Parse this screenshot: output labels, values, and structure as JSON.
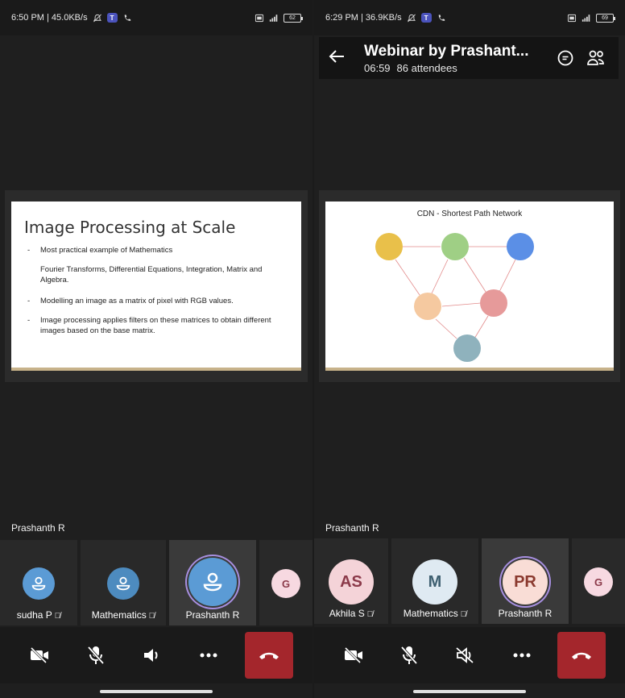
{
  "left": {
    "status": {
      "time": "6:50 PM | 45.0KB/s",
      "battery": "62"
    },
    "slide": {
      "title": "Image Processing at Scale",
      "bullets": [
        "Most practical example of Mathematics",
        "Modelling an image as a matrix of pixel with RGB values.",
        "Image processing applies filters on these matrices to obtain different images based on the base matrix."
      ],
      "note": "Fourier Transforms,  Differential Equations, Integration, Matrix and Algebra.",
      "dash": "-"
    },
    "speaker": "Prashanth R",
    "participants": [
      {
        "name": "sudha P",
        "avatar_color": "#5b9bd5",
        "icon": "person-icon"
      },
      {
        "name": "Mathematics",
        "avatar_color": "#4d8bbf",
        "icon": "person-icon"
      },
      {
        "name": "Prashanth R",
        "avatar_color": "#5b9bd5",
        "icon": "person-icon"
      },
      {
        "initial": "G",
        "avatar_color": "#f7d9e1",
        "text_color": "#8b3a4a"
      }
    ]
  },
  "right": {
    "status": {
      "time": "6:29 PM | 36.9KB/s",
      "battery": "69"
    },
    "header": {
      "title": "Webinar by Prashant...",
      "duration": "06:59",
      "attendees": "86 attendees"
    },
    "slide": {
      "title": "CDN - Shortest Path Network",
      "nodes": [
        {
          "id": "a",
          "color": "#e9c04a"
        },
        {
          "id": "b",
          "color": "#9fcf85"
        },
        {
          "id": "c",
          "color": "#5b8fe6"
        },
        {
          "id": "d",
          "color": "#f5c9a0"
        },
        {
          "id": "e",
          "color": "#e69a9a"
        },
        {
          "id": "f",
          "color": "#8fb2bd"
        }
      ],
      "edge_color": "#e28a8a"
    },
    "speaker": "Prashanth R",
    "participants": [
      {
        "initial": "AS",
        "name": "Akhila S",
        "avatar_color": "#f4d3d8",
        "text_color": "#8b3a4a"
      },
      {
        "initial": "M",
        "name": "Mathematics",
        "avatar_color": "#dfeaf2",
        "text_color": "#3e5f70"
      },
      {
        "initial": "PR",
        "name": "Prashanth R",
        "avatar_color": "#f9ddd6",
        "text_color": "#8b3a2f"
      },
      {
        "initial": "G",
        "avatar_color": "#f7d9e1",
        "text_color": "#8b3a4a"
      }
    ]
  },
  "controls": [
    "camera-off-icon",
    "mic-off-icon",
    "speaker-icon",
    "more-icon",
    "hang-up-icon"
  ],
  "colors": {
    "hangup": "#a4262c",
    "active_ring": "#a78fe0",
    "background": "#1f1f1f"
  }
}
